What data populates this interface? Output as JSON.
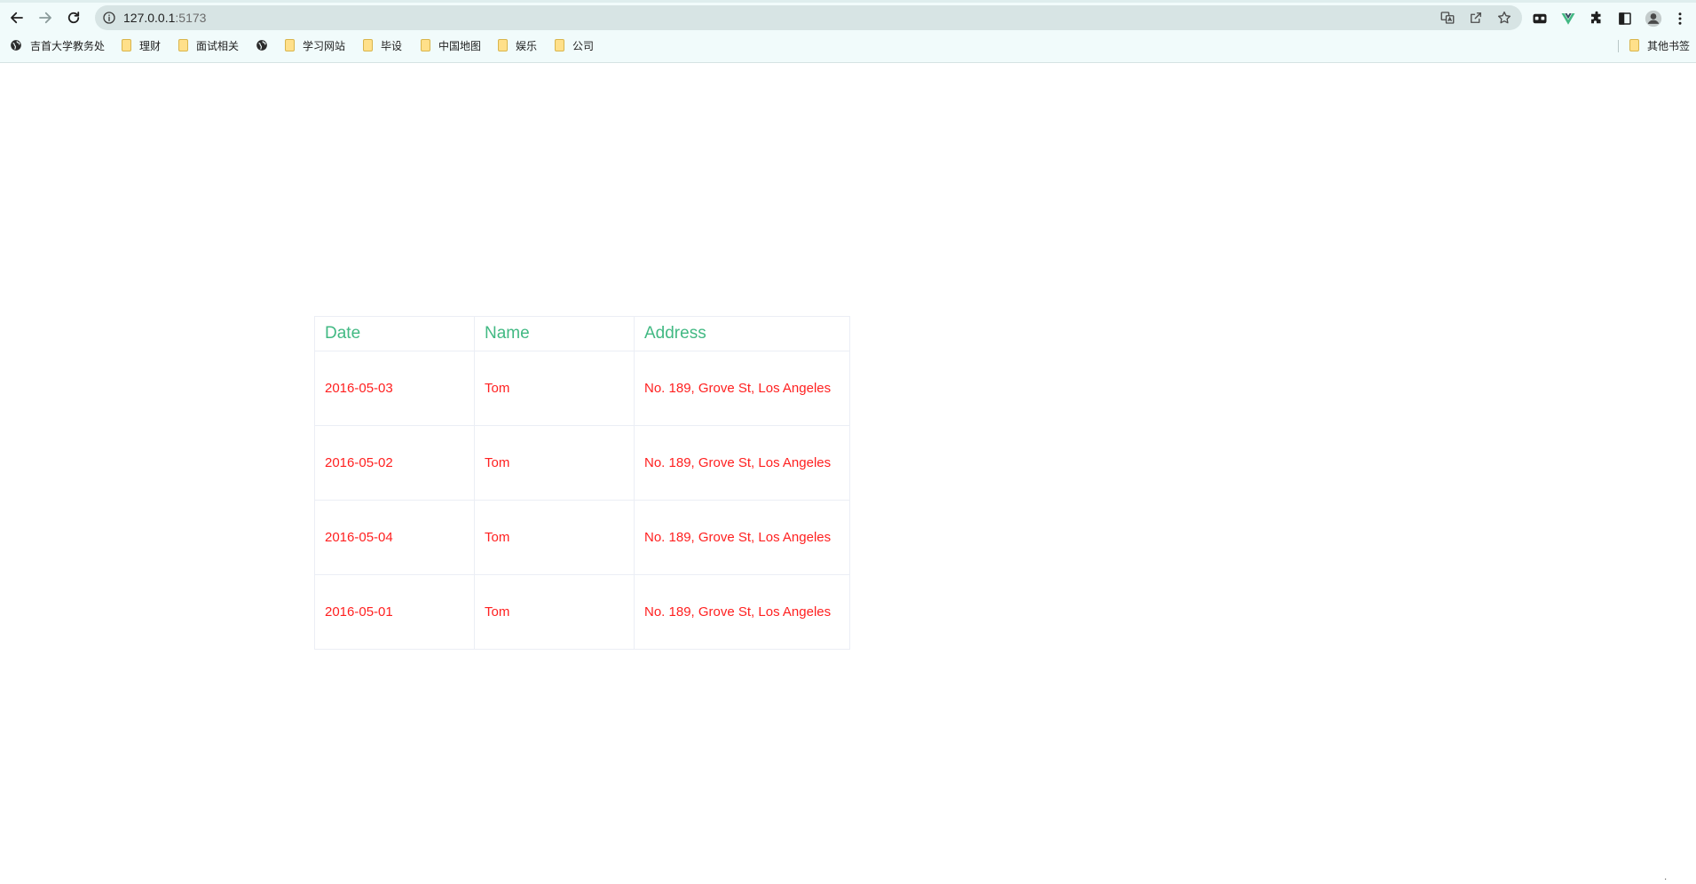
{
  "browser": {
    "url": {
      "host": "127.0.0.1",
      "port": ":5173"
    },
    "bookmarks": [
      {
        "label": "吉首大学教务处",
        "icon": "globe-icon"
      },
      {
        "label": "理财",
        "icon": "folder-icon"
      },
      {
        "label": "面试相关",
        "icon": "folder-icon"
      },
      {
        "label": "",
        "icon": "globe-icon"
      },
      {
        "label": "学习网站",
        "icon": "folder-icon"
      },
      {
        "label": "毕设",
        "icon": "folder-icon"
      },
      {
        "label": "中国地图",
        "icon": "folder-icon"
      },
      {
        "label": "娱乐",
        "icon": "folder-icon"
      },
      {
        "label": "公司",
        "icon": "folder-icon"
      }
    ],
    "other_bookmarks": "其他书签"
  },
  "table": {
    "columns": [
      "Date",
      "Name",
      "Address"
    ],
    "rows": [
      [
        "2016-05-03",
        "Tom",
        "No. 189, Grove St, Los Angeles"
      ],
      [
        "2016-05-02",
        "Tom",
        "No. 189, Grove St, Los Angeles"
      ],
      [
        "2016-05-04",
        "Tom",
        "No. 189, Grove St, Los Angeles"
      ],
      [
        "2016-05-01",
        "Tom",
        "No. 189, Grove St, Los Angeles"
      ]
    ]
  },
  "colors": {
    "header_text": "#42b983",
    "cell_text": "#ff2020",
    "border": "#ebeef5",
    "chrome_bg": "#f1fbfb",
    "omnibox_bg": "#d7e4e4"
  }
}
